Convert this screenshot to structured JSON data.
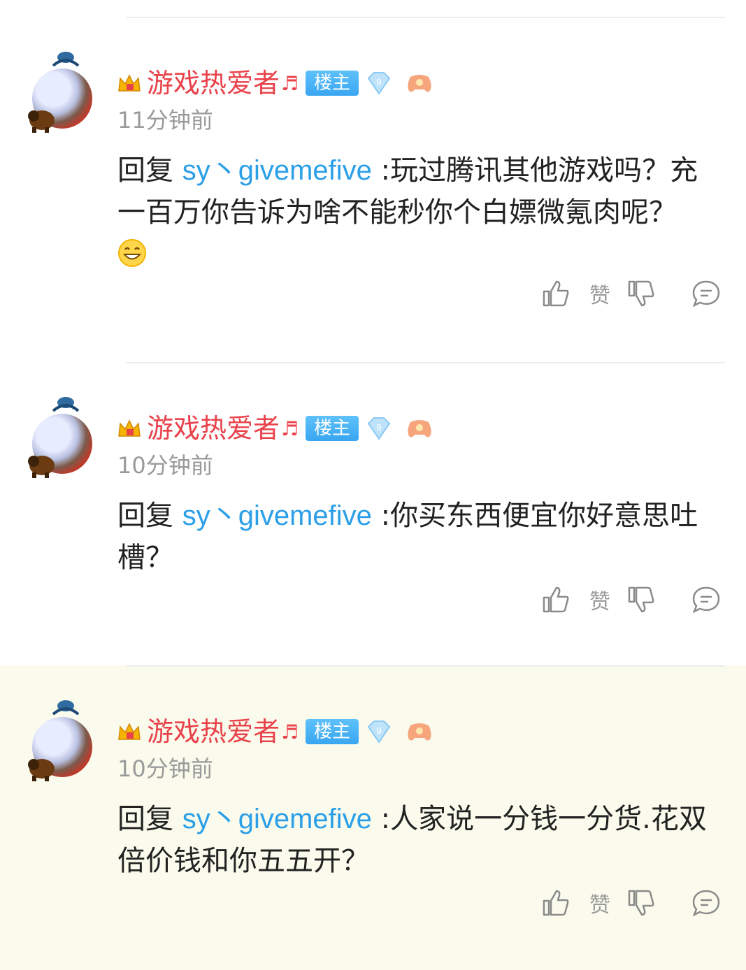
{
  "comments": [
    {
      "username": "游戏热爱者",
      "username_suffix": "♬",
      "owner_badge": "楼主",
      "level": "9",
      "time": "11分钟前",
      "reply_prefix": "回复",
      "mention": "sy丶givemefive",
      "text": ":玩过腾讯其他游戏吗？充一百万你告诉为啥不能秒你个白嫖微氪肉呢？",
      "emoji": "grin-emoji",
      "like_label": "赞",
      "highlighted": false
    },
    {
      "username": "游戏热爱者",
      "username_suffix": "♬",
      "owner_badge": "楼主",
      "level": "9",
      "time": "10分钟前",
      "reply_prefix": "回复",
      "mention": "sy丶givemefive",
      "text": ":你买东西便宜你好意思吐槽？",
      "like_label": "赞",
      "highlighted": false
    },
    {
      "username": "游戏热爱者",
      "username_suffix": "♬",
      "owner_badge": "楼主",
      "level": "9",
      "time": "10分钟前",
      "reply_prefix": "回复",
      "mention": "sy丶givemefive",
      "text": ":人家说一分钱一分货.花双倍价钱和你五五开？",
      "like_label": "赞",
      "highlighted": true
    }
  ],
  "colors": {
    "username": "#e9424b",
    "mention": "#2b9fe8",
    "owner_badge": "#39a6f1",
    "meta": "#9a9a9a",
    "highlight_bg": "#fbfbed"
  }
}
